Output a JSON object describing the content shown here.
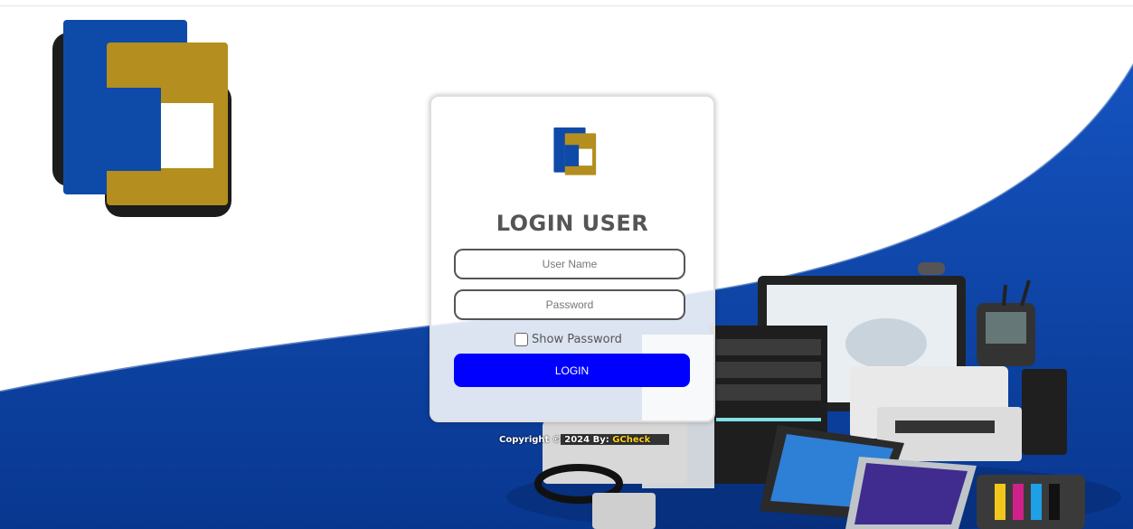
{
  "login": {
    "title": "LOGIN USER",
    "username_placeholder": "User Name",
    "password_placeholder": "Password",
    "show_password_label": "Show Password",
    "submit_label": "LOGIN"
  },
  "footer": {
    "copyright_prefix": "Copyright © 2024 By: ",
    "brand": "GCheck"
  },
  "colors": {
    "logo_blue": "#0e4aa8",
    "logo_gold": "#b48e1e",
    "logo_shadow": "#1c1c1c",
    "background_wave": "#0a3fa0",
    "login_button": "#0000ff",
    "brand_text": "#ffd21a"
  },
  "icons": {
    "logo": "gc-logo",
    "checkbox": "checkbox-unchecked"
  }
}
